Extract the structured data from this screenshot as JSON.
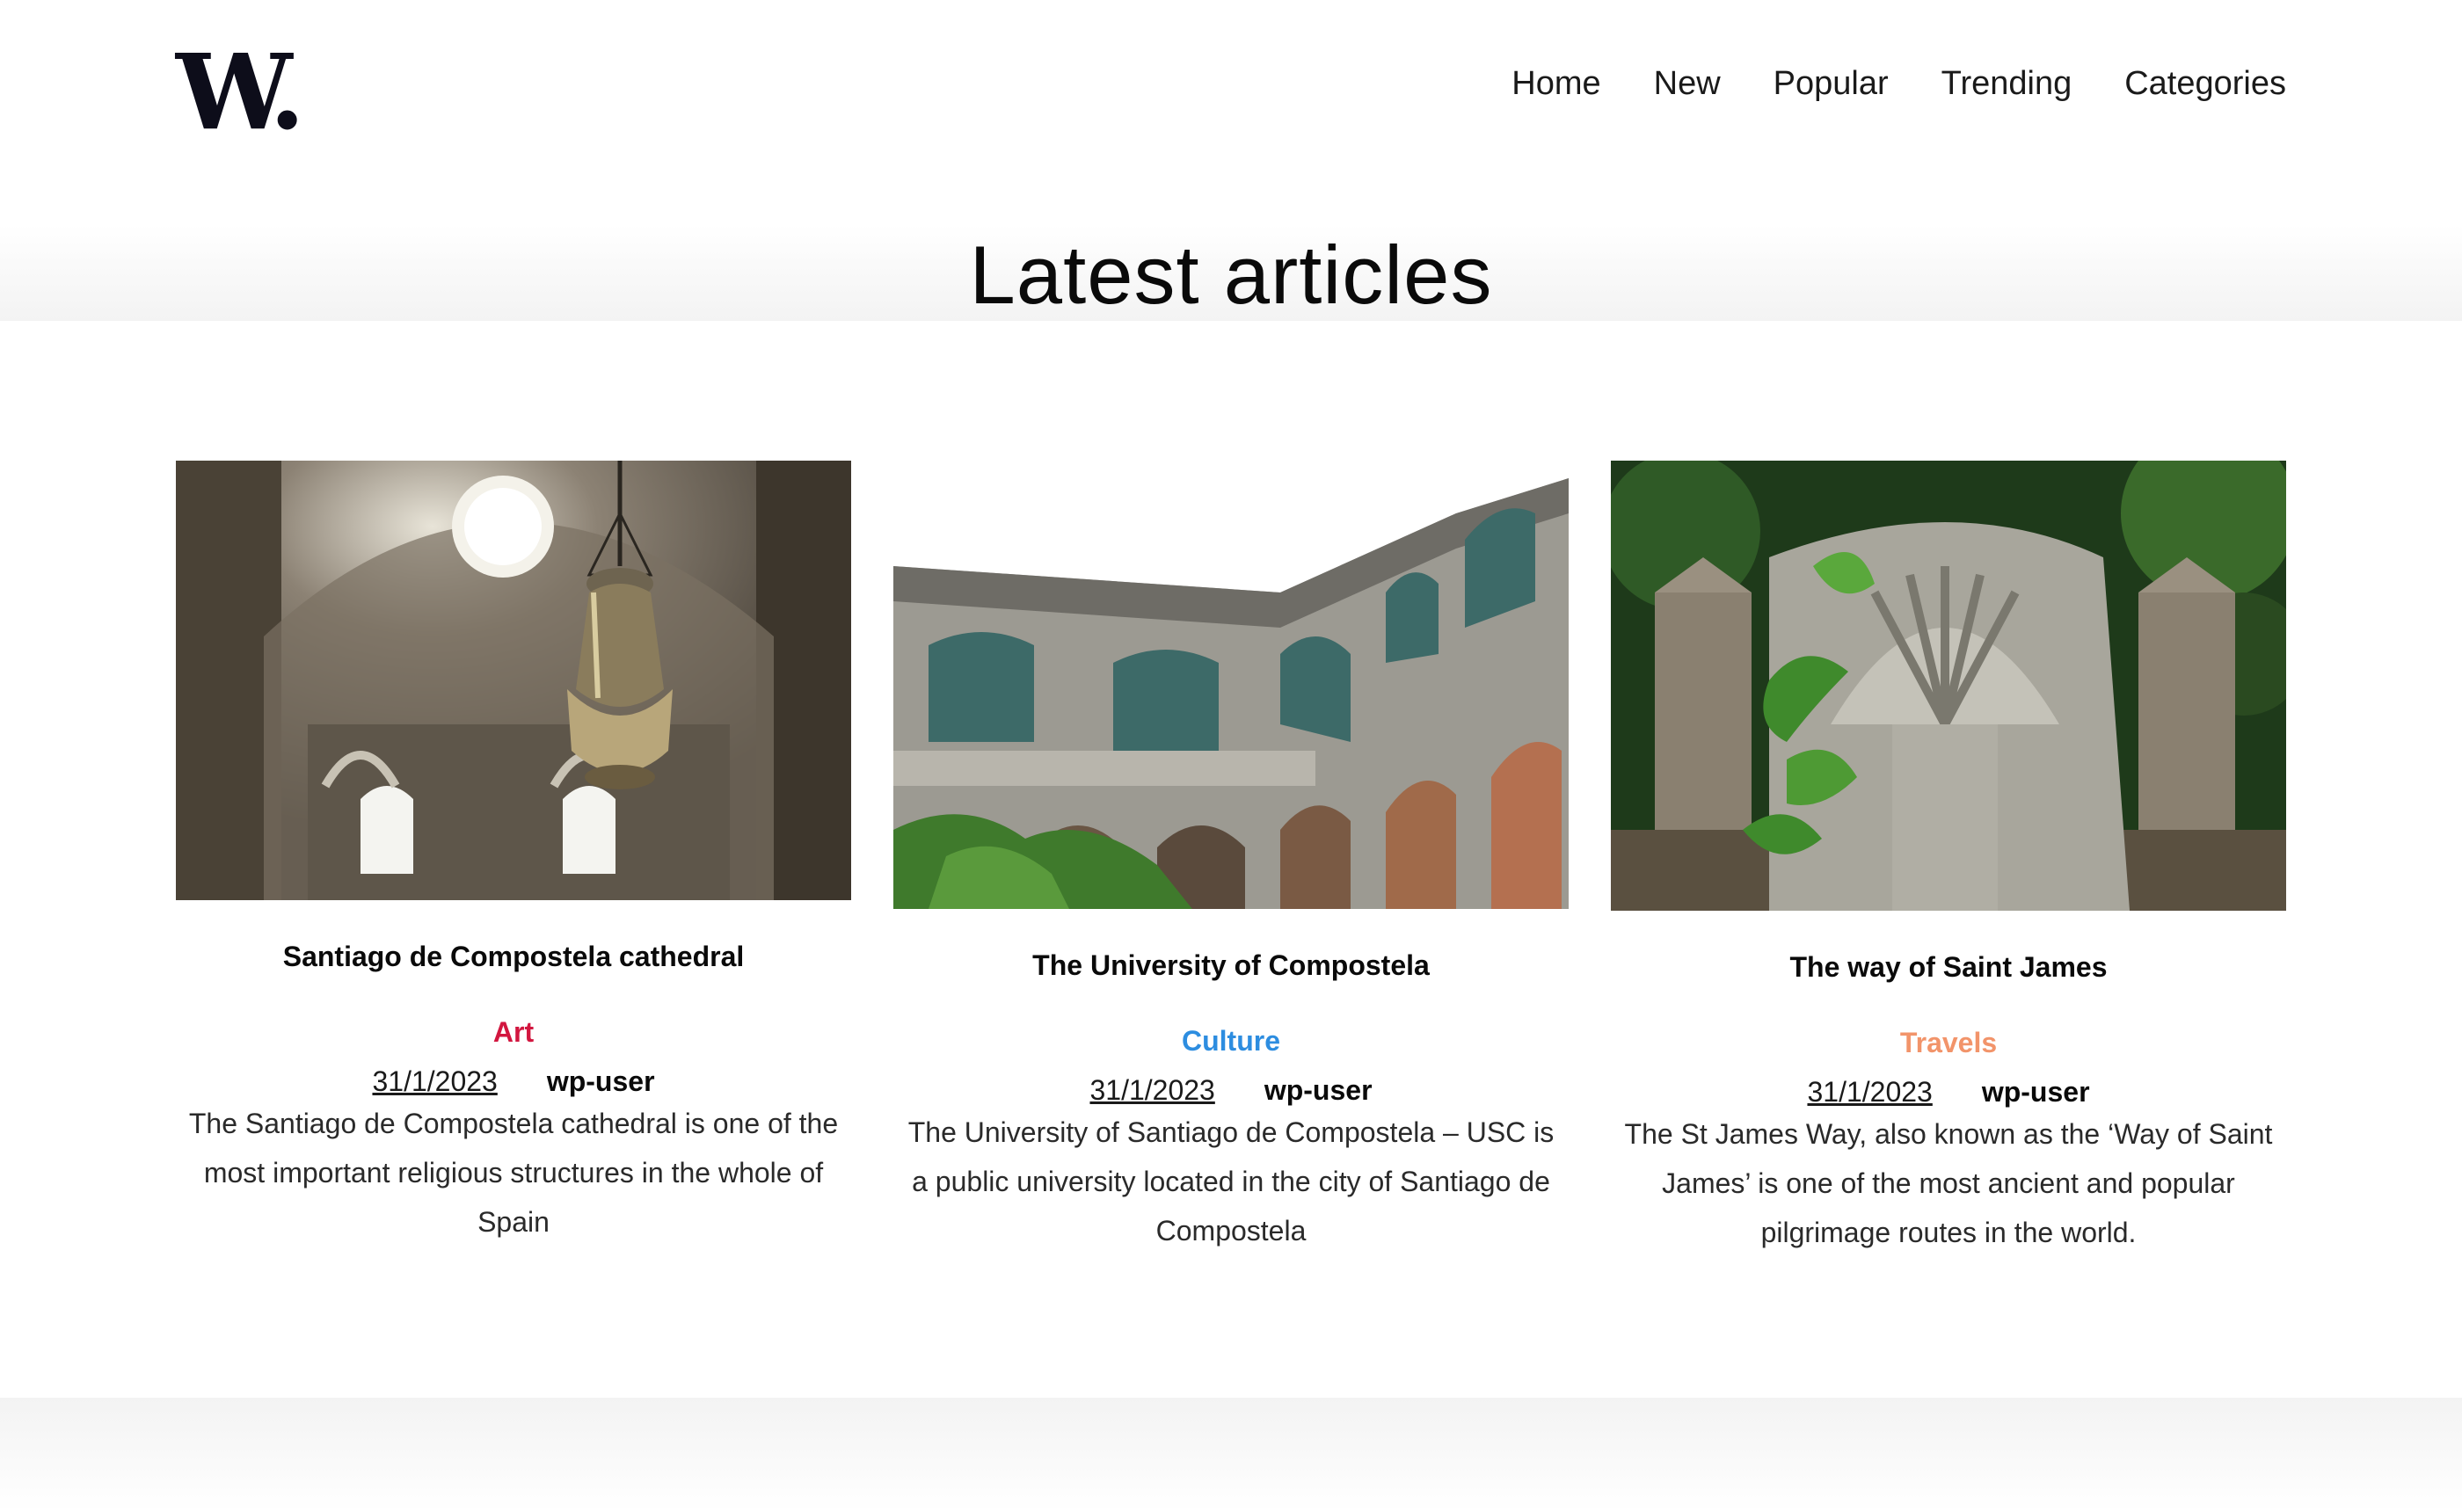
{
  "logo": "W.",
  "nav": [
    "Home",
    "New",
    "Popular",
    "Trending",
    "Categories"
  ],
  "heading": "Latest articles",
  "articles": [
    {
      "title": "Santiago de Compostela cathedral",
      "category": "Art",
      "category_color": "#d2163f",
      "date": "31/1/2023",
      "author": "wp-user",
      "excerpt": "The Santiago de Compostela cathedral is one of the most important religious structures in the whole of Spain",
      "image_icon": "cathedral-photo"
    },
    {
      "title": "The University of Compostela",
      "category": "Culture",
      "category_color": "#2d8de0",
      "date": "31/1/2023",
      "author": "wp-user",
      "excerpt": "The University of Santiago de Compostela – USC is a public university located in the city of Santiago de Compostela",
      "image_icon": "university-photo"
    },
    {
      "title": "The way of Saint James",
      "category": "Travels",
      "category_color": "#f2946a",
      "date": "31/1/2023",
      "author": "wp-user",
      "excerpt": "The St James Way, also known as the ‘Way of Saint James’ is one of the most ancient and popular pilgrimage routes in the world.",
      "image_icon": "scallop-stone-photo"
    }
  ]
}
